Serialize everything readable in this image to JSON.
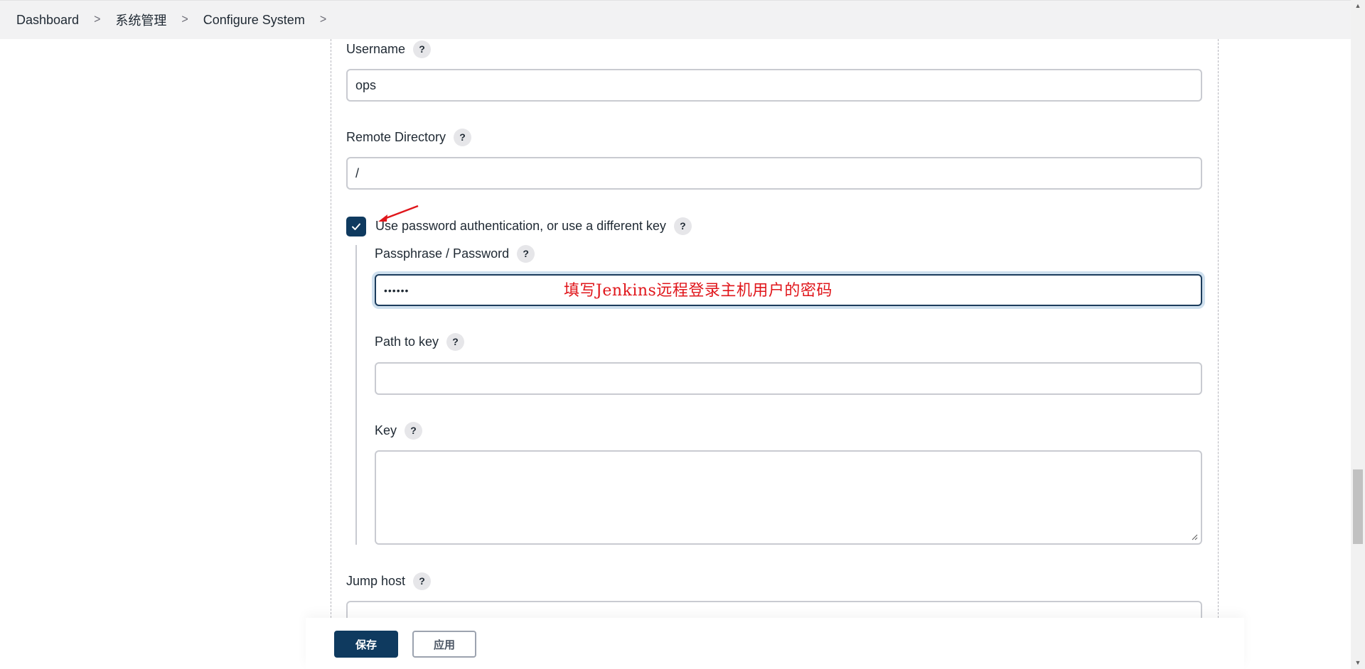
{
  "breadcrumb": {
    "items": [
      "Dashboard",
      "系统管理",
      "Configure System"
    ]
  },
  "form": {
    "username": {
      "label": "Username",
      "value": "ops"
    },
    "remote_directory": {
      "label": "Remote Directory",
      "value": "/"
    },
    "use_password": {
      "label": "Use password authentication, or use a different key",
      "checked": true
    },
    "passphrase": {
      "label": "Passphrase / Password",
      "value": "••••••"
    },
    "path_to_key": {
      "label": "Path to key",
      "value": ""
    },
    "key": {
      "label": "Key",
      "value": ""
    },
    "jump_host": {
      "label": "Jump host",
      "value": ""
    }
  },
  "help_glyph": "?",
  "annotation": {
    "text": "填写Jenkins远程登录主机用户的密码",
    "color": "#e0161b"
  },
  "buttons": {
    "save": "保存",
    "apply": "应用"
  },
  "colors": {
    "primary": "#0f3a5f",
    "focus_ring": "#cfe0ee"
  }
}
